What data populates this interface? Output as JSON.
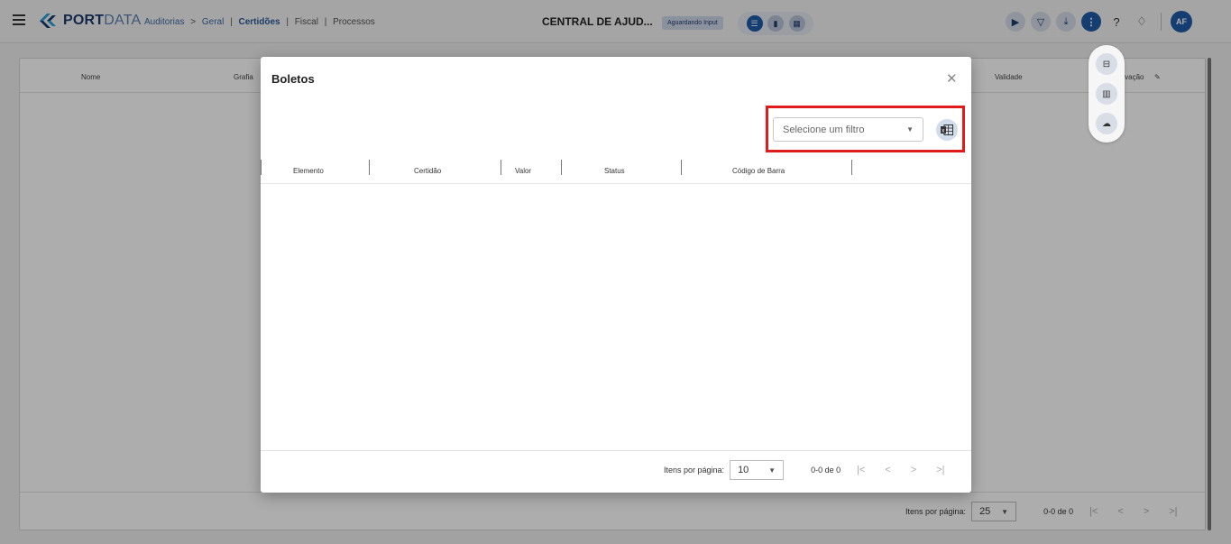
{
  "topbar": {
    "logo_bold": "PORT",
    "logo_light": "DATA",
    "breadcrumb": [
      "Auditorias",
      ">",
      "Geral",
      "|",
      "Certidões",
      "|",
      "Fiscal",
      "|",
      "Processos"
    ],
    "center_title": "CENTRAL DE AJUD...",
    "status_pill": "Aguardando Input",
    "avatar_initials": "AF",
    "icons": [
      "menu-icon",
      "play-circle-icon",
      "filter-icon",
      "download-icon",
      "more-vertical-icon",
      "help-icon",
      "bell-icon"
    ]
  },
  "floating_menu": {
    "icons": [
      "column-remove-icon",
      "barcode-icon",
      "cloud-upload-icon"
    ]
  },
  "background_table": {
    "headers": {
      "nome": "Nome",
      "grafia": "Grafia",
      "validade": "Validade",
      "observacao": "ervação"
    },
    "footer": {
      "items_label": "Itens por página:",
      "page_size": "25",
      "range": "0-0 de 0"
    }
  },
  "modal": {
    "title": "Boletos",
    "close_icon": "close-icon",
    "filter_placeholder": "Selecione um filtro",
    "export_icon": "excel-export-icon",
    "columns": [
      "Elemento",
      "Certidão",
      "Valor",
      "Status",
      "Código de Barra"
    ],
    "footer": {
      "items_label": "Itens por página:",
      "page_size": "10",
      "range": "0-0 de 0"
    }
  },
  "colors": {
    "brand": "#1e5aa8",
    "highlight": "#e01b1b"
  }
}
